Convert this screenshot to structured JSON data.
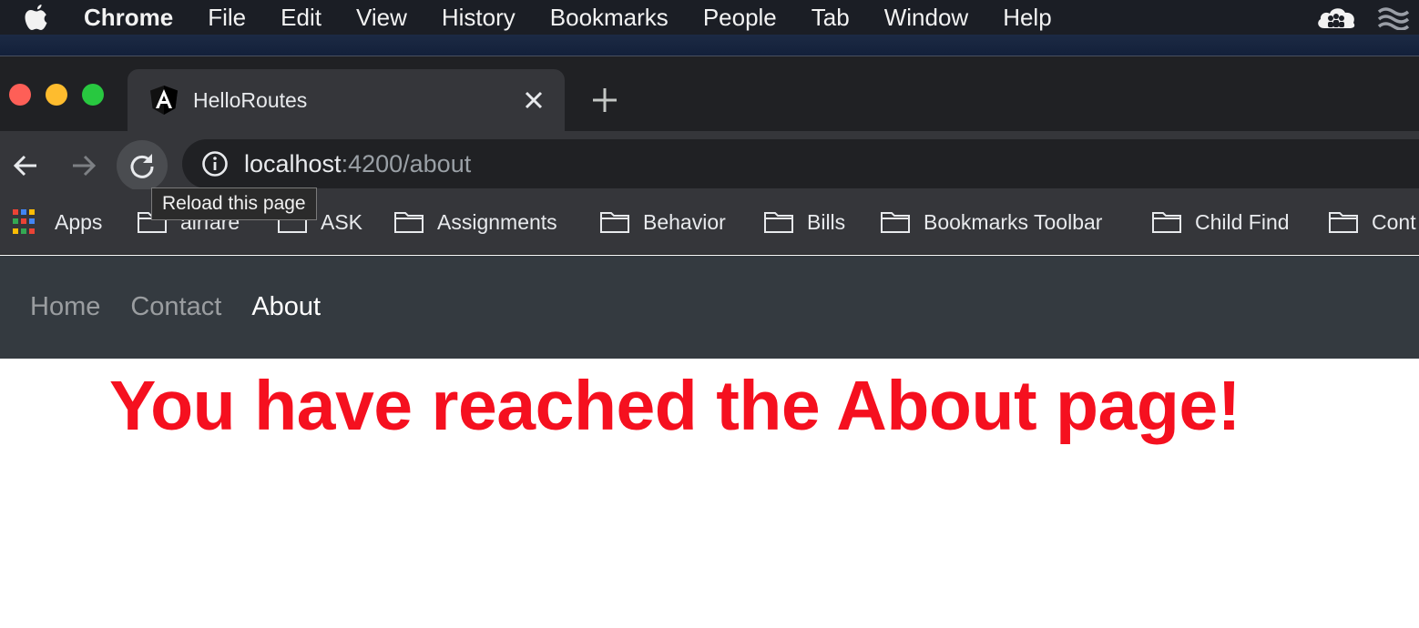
{
  "menubar": {
    "app_name": "Chrome",
    "items": [
      "File",
      "Edit",
      "View",
      "History",
      "Bookmarks",
      "People",
      "Tab",
      "Window",
      "Help"
    ]
  },
  "browser": {
    "tab": {
      "title": "HelloRoutes"
    },
    "omnibox": {
      "host": "localhost",
      "path": ":4200/about"
    },
    "tooltip": "Reload this page",
    "bookmarks": {
      "apps_label": "Apps",
      "items": [
        "airfare",
        "ASK",
        "Assignments",
        "Behavior",
        "Bills",
        "Bookmarks Toolbar",
        "Child Find",
        "Cont"
      ]
    }
  },
  "app": {
    "nav": {
      "home": "Home",
      "contact": "Contact",
      "about": "About",
      "active": "About"
    },
    "headline": "You have reached the About page!"
  },
  "colors": {
    "headline": "#f5101f",
    "navbar": "#343a40",
    "chrome_dark": "#202124",
    "chrome_toolbar": "#35363a"
  }
}
